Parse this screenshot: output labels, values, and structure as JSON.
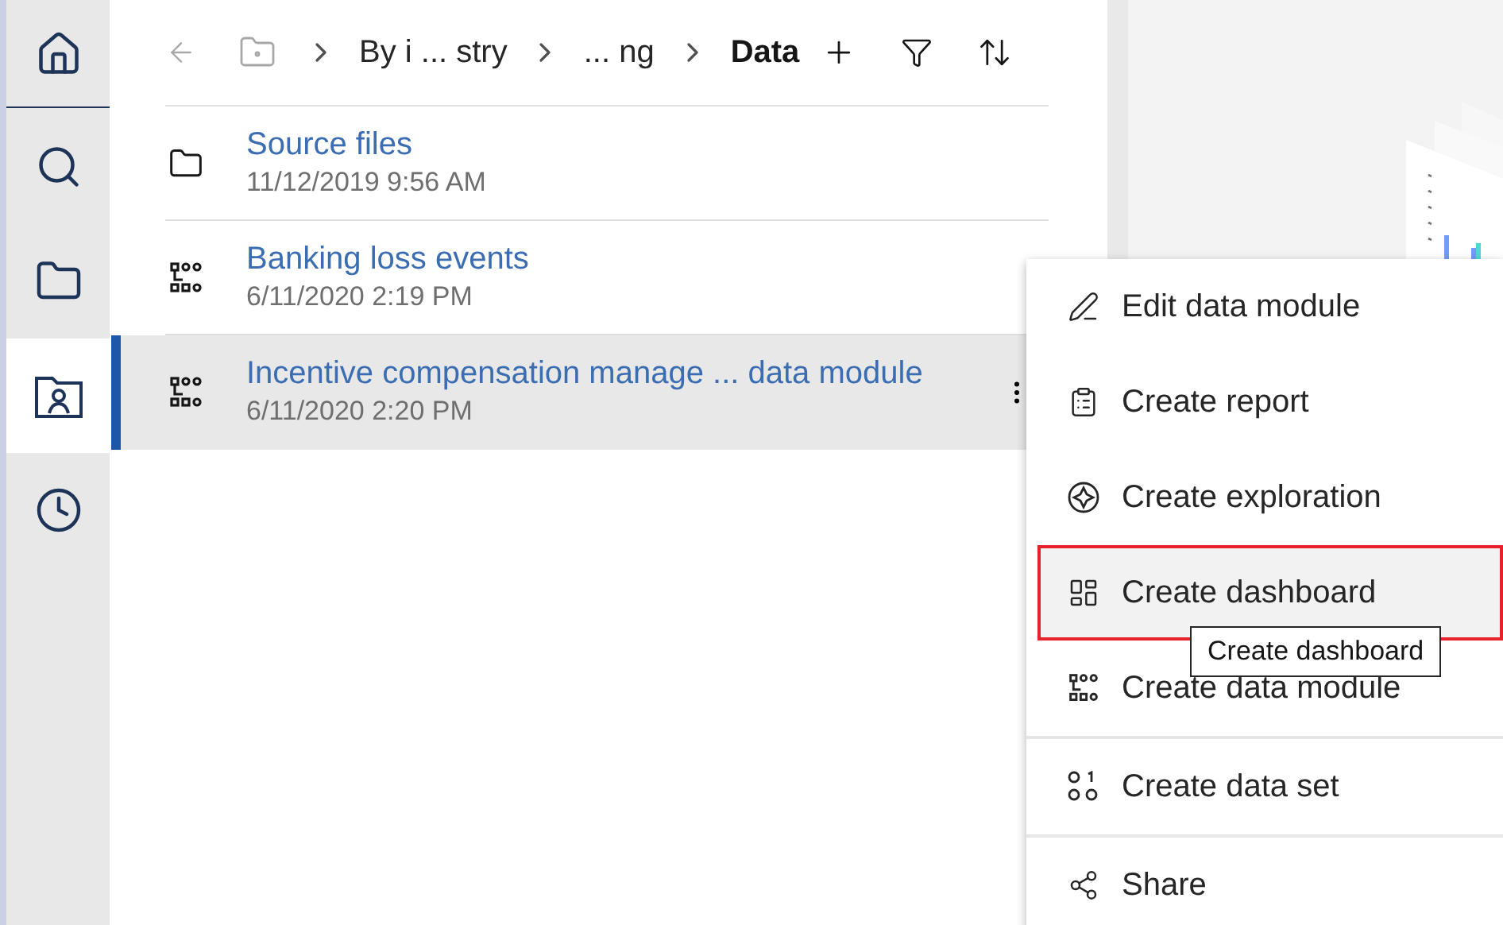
{
  "rail": [
    {
      "kind": "home",
      "selected": false
    },
    {
      "kind": "search",
      "selected": false
    },
    {
      "kind": "folder",
      "selected": false
    },
    {
      "kind": "team",
      "selected": true
    },
    {
      "kind": "recent",
      "selected": false
    }
  ],
  "breadcrumb": {
    "back_disabled": true,
    "crumbs": [
      "By i ... stry",
      "... ng"
    ],
    "current": "Data"
  },
  "rows": [
    {
      "kind": "folder",
      "title": "Source files",
      "date": "11/12/2019 9:56 AM",
      "selected": false
    },
    {
      "kind": "module",
      "title": "Banking loss events",
      "date": "6/11/2020 2:19 PM",
      "selected": false
    },
    {
      "kind": "module",
      "title": "Incentive compensation manage ... data module",
      "date": "6/11/2020 2:20 PM",
      "selected": true
    }
  ],
  "menu": {
    "groups": [
      [
        {
          "kind": "edit",
          "label": "Edit data module",
          "selected": false
        },
        {
          "kind": "report",
          "label": "Create report",
          "selected": false
        },
        {
          "kind": "exploration",
          "label": "Create exploration",
          "selected": false
        },
        {
          "kind": "dashboard",
          "label": "Create dashboard",
          "selected": true
        },
        {
          "kind": "module",
          "label": "Create data module",
          "selected": false
        }
      ],
      [
        {
          "kind": "dataset",
          "label": "Create data set",
          "selected": false
        }
      ],
      [
        {
          "kind": "share",
          "label": "Share",
          "selected": false
        }
      ]
    ]
  },
  "tooltip": {
    "text": "Create dashboard"
  }
}
